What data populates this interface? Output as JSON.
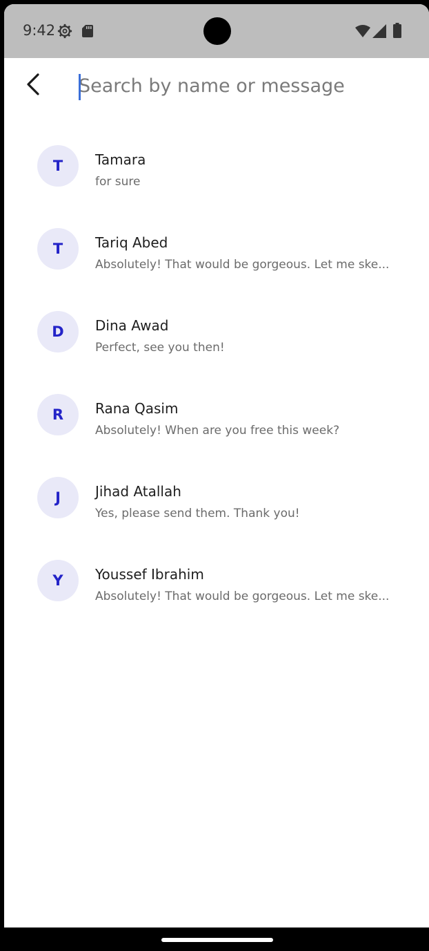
{
  "status_bar": {
    "time": "9:42",
    "icons": [
      "settings-gear-icon",
      "sd-card-icon",
      "wifi-icon",
      "cell-signal-icon",
      "battery-icon"
    ]
  },
  "header": {
    "back_icon": "chevron-left-icon",
    "search_placeholder": "Search by name or message",
    "search_value": ""
  },
  "colors": {
    "avatar_bg": "#e9e9f8",
    "avatar_text": "#2424c8",
    "caret": "#3b6fd8",
    "status_bar_bg": "#bdbdbd"
  },
  "conversations": [
    {
      "initial": "T",
      "name": "Tamara",
      "message": "for sure"
    },
    {
      "initial": "T",
      "name": "Tariq Abed",
      "message": "Absolutely! That would be gorgeous. Let me ske..."
    },
    {
      "initial": "D",
      "name": "Dina Awad",
      "message": "Perfect, see you then!"
    },
    {
      "initial": "R",
      "name": "Rana Qasim",
      "message": "Absolutely! When are you free this week?"
    },
    {
      "initial": "J",
      "name": "Jihad Atallah",
      "message": "Yes, please send them. Thank you!"
    },
    {
      "initial": "Y",
      "name": "Youssef Ibrahim",
      "message": "Absolutely! That would be gorgeous. Let me ske..."
    }
  ]
}
